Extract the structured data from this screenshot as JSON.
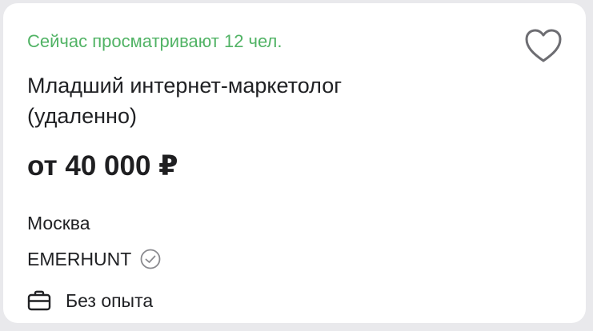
{
  "vacancy": {
    "viewers_text": "Сейчас просматривают 12 чел.",
    "title_line1": "Младший интернет-маркетолог",
    "title_line2": "(удаленно)",
    "salary": "от 40 000 ₽",
    "city": "Москва",
    "company": "EMERHUNT",
    "experience": "Без опыта"
  },
  "icons": {
    "favorite": "heart-outline-icon",
    "verified": "check-circle-icon",
    "experience": "briefcase-icon"
  },
  "colors": {
    "viewers": "#51b365",
    "text": "#202124",
    "icon": "#6d6d72"
  }
}
